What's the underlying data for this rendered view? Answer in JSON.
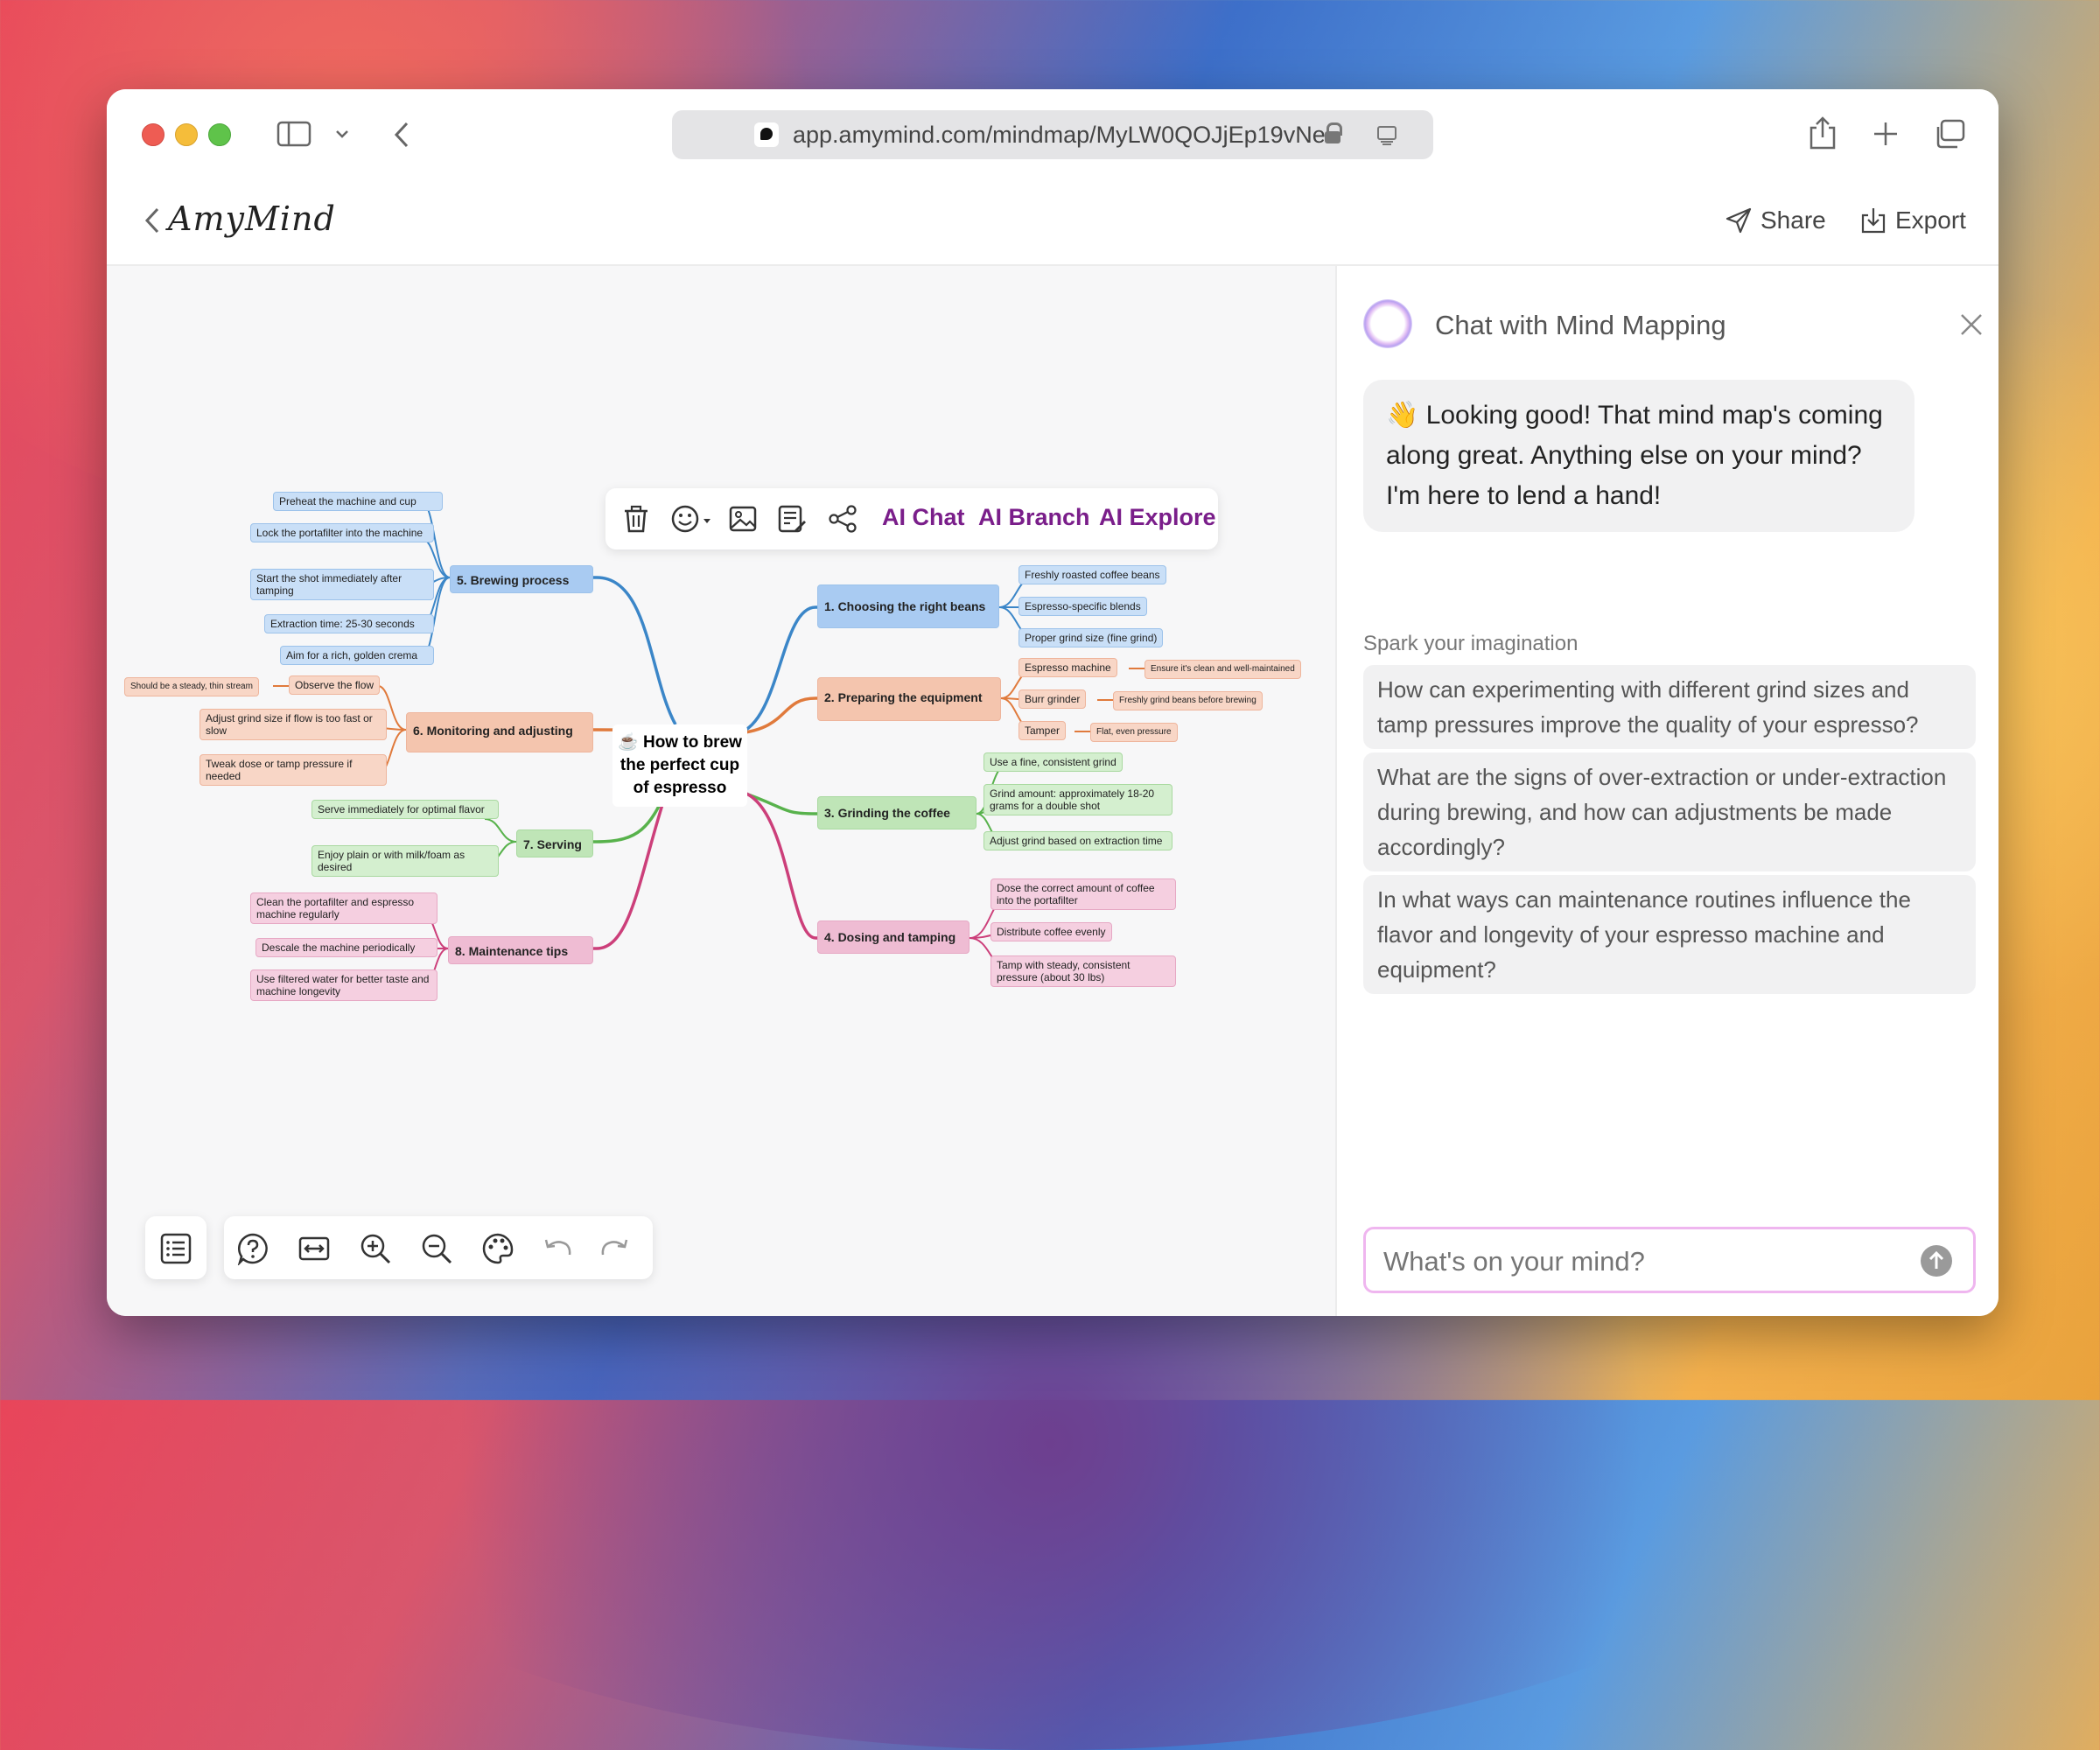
{
  "browser": {
    "url": "app.amymind.com/mindmap/MyLW0QOJjEp19vNe"
  },
  "app": {
    "logo": "AmyMind",
    "share_label": "Share",
    "export_label": "Export"
  },
  "toolbar": {
    "ai_chat": "AI Chat",
    "ai_branch": "AI Branch",
    "ai_explore": "AI Explore"
  },
  "mindmap": {
    "root": "☕ How to brew the perfect cup of espresso",
    "colors": {
      "blue": "#3b86c8",
      "orange": "#e07a3c",
      "green": "#58b24c",
      "pink": "#cc3f7a"
    },
    "b1": {
      "title": "1. Choosing the right beans",
      "c": [
        "Freshly roasted coffee beans",
        "Espresso-specific blends",
        "Proper grind size (fine grind)"
      ]
    },
    "b2": {
      "title": "2. Preparing the equipment",
      "c": [
        "Espresso machine",
        "Burr grinder",
        "Tamper"
      ],
      "g": [
        "Ensure it's clean and well-maintained",
        "Freshly grind beans before brewing",
        "Flat, even pressure"
      ]
    },
    "b3": {
      "title": "3. Grinding the coffee",
      "c": [
        "Use a fine, consistent grind",
        "Grind amount: approximately 18-20 grams for a double shot",
        "Adjust grind based on extraction time"
      ]
    },
    "b4": {
      "title": "4. Dosing and tamping",
      "c": [
        "Dose the correct amount of coffee into the portafilter",
        "Distribute coffee evenly",
        "Tamp with steady, consistent pressure (about 30 lbs)"
      ]
    },
    "b5": {
      "title": "5. Brewing process",
      "c": [
        "Preheat the machine and cup",
        "Lock the portafilter into the machine",
        "Start the shot immediately after tamping",
        "Extraction time: 25-30 seconds",
        "Aim for a rich, golden crema"
      ]
    },
    "b6": {
      "title": "6. Monitoring and adjusting",
      "c": [
        "Observe the flow",
        "Adjust grind size if flow is too fast or slow",
        "Tweak dose or tamp pressure if needed"
      ],
      "g": [
        "Should be a steady, thin stream"
      ]
    },
    "b7": {
      "title": "7. Serving",
      "c": [
        "Serve immediately for optimal flavor",
        "Enjoy plain or with milk/foam as desired"
      ]
    },
    "b8": {
      "title": "8. Maintenance tips",
      "c": [
        "Clean the portafilter and espresso machine regularly",
        "Descale the machine periodically",
        "Use filtered water for better taste and machine longevity"
      ]
    }
  },
  "chat": {
    "title": "Chat with Mind Mapping",
    "message": "👋 Looking good! That mind map's coming along great. Anything else on your mind? I'm here to lend a hand!",
    "spark_label": "Spark your imagination",
    "suggestions": [
      "How can experimenting with different grind sizes and tamp pressures improve the quality of your espresso?",
      "What are the signs of over-extraction or under-extraction during brewing, and how can adjustments be made accordingly?",
      "In what ways can maintenance routines influence the flavor and longevity of your espresso machine and equipment?"
    ],
    "input_placeholder": "What's on your mind?"
  }
}
